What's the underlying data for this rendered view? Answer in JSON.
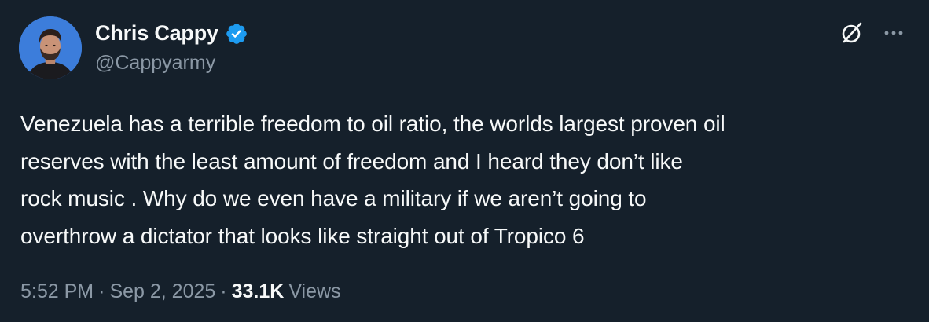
{
  "author": {
    "display_name": "Chris Cappy",
    "handle": "@Cappyarmy",
    "verified": true,
    "avatar_icon": "profile-photo"
  },
  "actions": {
    "grok_icon": "grok-icon",
    "more_icon": "more-icon"
  },
  "tweet": {
    "text": "Venezuela has a terrible freedom to oil ratio, the worlds largest proven oil\nreserves with the least amount of freedom and I heard they don’t like\nrock music . Why do we even have a military if we aren’t going to\noverthrow a dictator that looks like straight out of Tropico 6"
  },
  "meta": {
    "time": "5:52 PM",
    "separator": "·",
    "date": "Sep 2, 2025",
    "views_count": "33.1K",
    "views_label": "Views"
  },
  "colors": {
    "background": "#15202b",
    "text_primary": "#f7f9f9",
    "text_secondary": "#8b98a5",
    "verified_badge": "#1d9bf0"
  }
}
